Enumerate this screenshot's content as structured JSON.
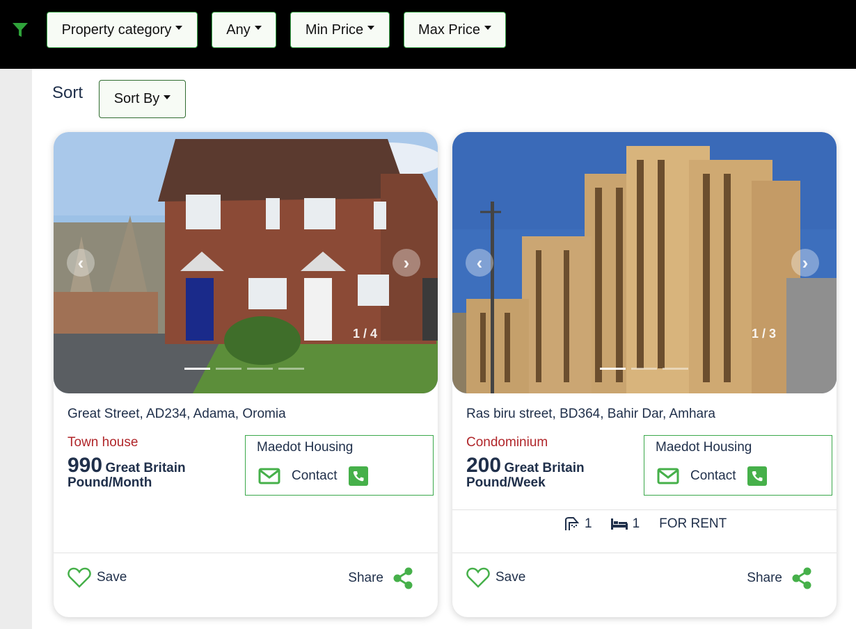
{
  "filters": {
    "category_label": "Property category",
    "any_label": "Any",
    "min_price_label": "Min Price",
    "max_price_label": "Max Price"
  },
  "sort": {
    "label": "Sort",
    "button_label": "Sort By"
  },
  "listings": [
    {
      "counter": "1 / 4",
      "address": "Great Street, AD234, Adama, Oromia",
      "type": "Town house",
      "price": "990",
      "price_unit": "Great Britain Pound/Month",
      "agent": "Maedot Housing",
      "contact_label": "Contact",
      "save_label": "Save",
      "share_label": "Share"
    },
    {
      "counter": "1 / 3",
      "address": "Ras biru street, BD364, Bahir Dar, Amhara",
      "type": "Condominium",
      "price": "200",
      "price_unit": "Great Britain Pound/Week",
      "agent": "Maedot Housing",
      "contact_label": "Contact",
      "baths": "1",
      "beds": "1",
      "status": "FOR RENT",
      "save_label": "Save",
      "share_label": "Share"
    }
  ],
  "colors": {
    "accent_green": "#46b04a",
    "type_red": "#b0262a",
    "text_navy": "#1f2f4a"
  }
}
